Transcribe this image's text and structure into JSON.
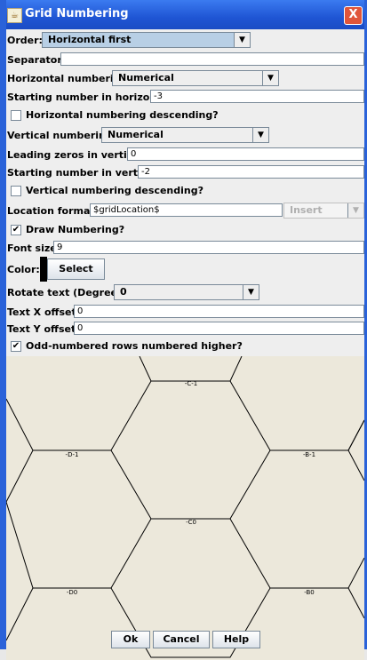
{
  "window": {
    "title": "Grid Numbering",
    "close_glyph": "X"
  },
  "fields": {
    "order_label": "Order:",
    "order_value": "Horizontal first",
    "separator_label": "Separator:",
    "separator_value": "",
    "h_numbering_label": "Horizontal numbering:",
    "h_numbering_value": "Numerical",
    "h_start_label": "Starting number in horizontal:",
    "h_start_value": "-3",
    "h_desc_label": "Horizontal numbering descending?",
    "v_numbering_label": "Vertical numbering:",
    "v_numbering_value": "Numerical",
    "v_zeros_label": "Leading zeros in vertical:",
    "v_zeros_value": "0",
    "v_start_label": "Starting number in vertical:",
    "v_start_value": "-2",
    "v_desc_label": "Vertical numbering descending?",
    "loc_label": "Location format:",
    "loc_value": "$gridLocation$",
    "insert_value": "Insert",
    "draw_label": "Draw Numbering?",
    "font_label": "Font size:",
    "font_value": "9",
    "color_label": "Color:",
    "select_button": "Select",
    "rotate_label": "Rotate text (Degrees):",
    "rotate_value": "0",
    "xoff_label": "Text X offset:",
    "xoff_value": "0",
    "yoff_label": "Text Y offset:",
    "yoff_value": "0",
    "odd_label": "Odd-numbered rows numbered higher?"
  },
  "checkboxes": {
    "h_desc": false,
    "v_desc": false,
    "draw": true,
    "odd": true
  },
  "preview": {
    "labels": [
      "-C-1",
      "-D-1",
      "-B-1",
      "-C0",
      "-D0",
      "-B0"
    ]
  },
  "buttons": {
    "ok": "Ok",
    "cancel": "Cancel",
    "help": "Help"
  },
  "colors": {
    "title_bar": "#1f55d4",
    "selected_combo": "#b8cfe5",
    "preview_bg": "#ece8db",
    "number_color": "#000000"
  },
  "icons": {
    "window_icon": "java-cup-icon",
    "close": "close-icon",
    "dropdown": "chevron-down-icon",
    "check": "check-icon"
  }
}
